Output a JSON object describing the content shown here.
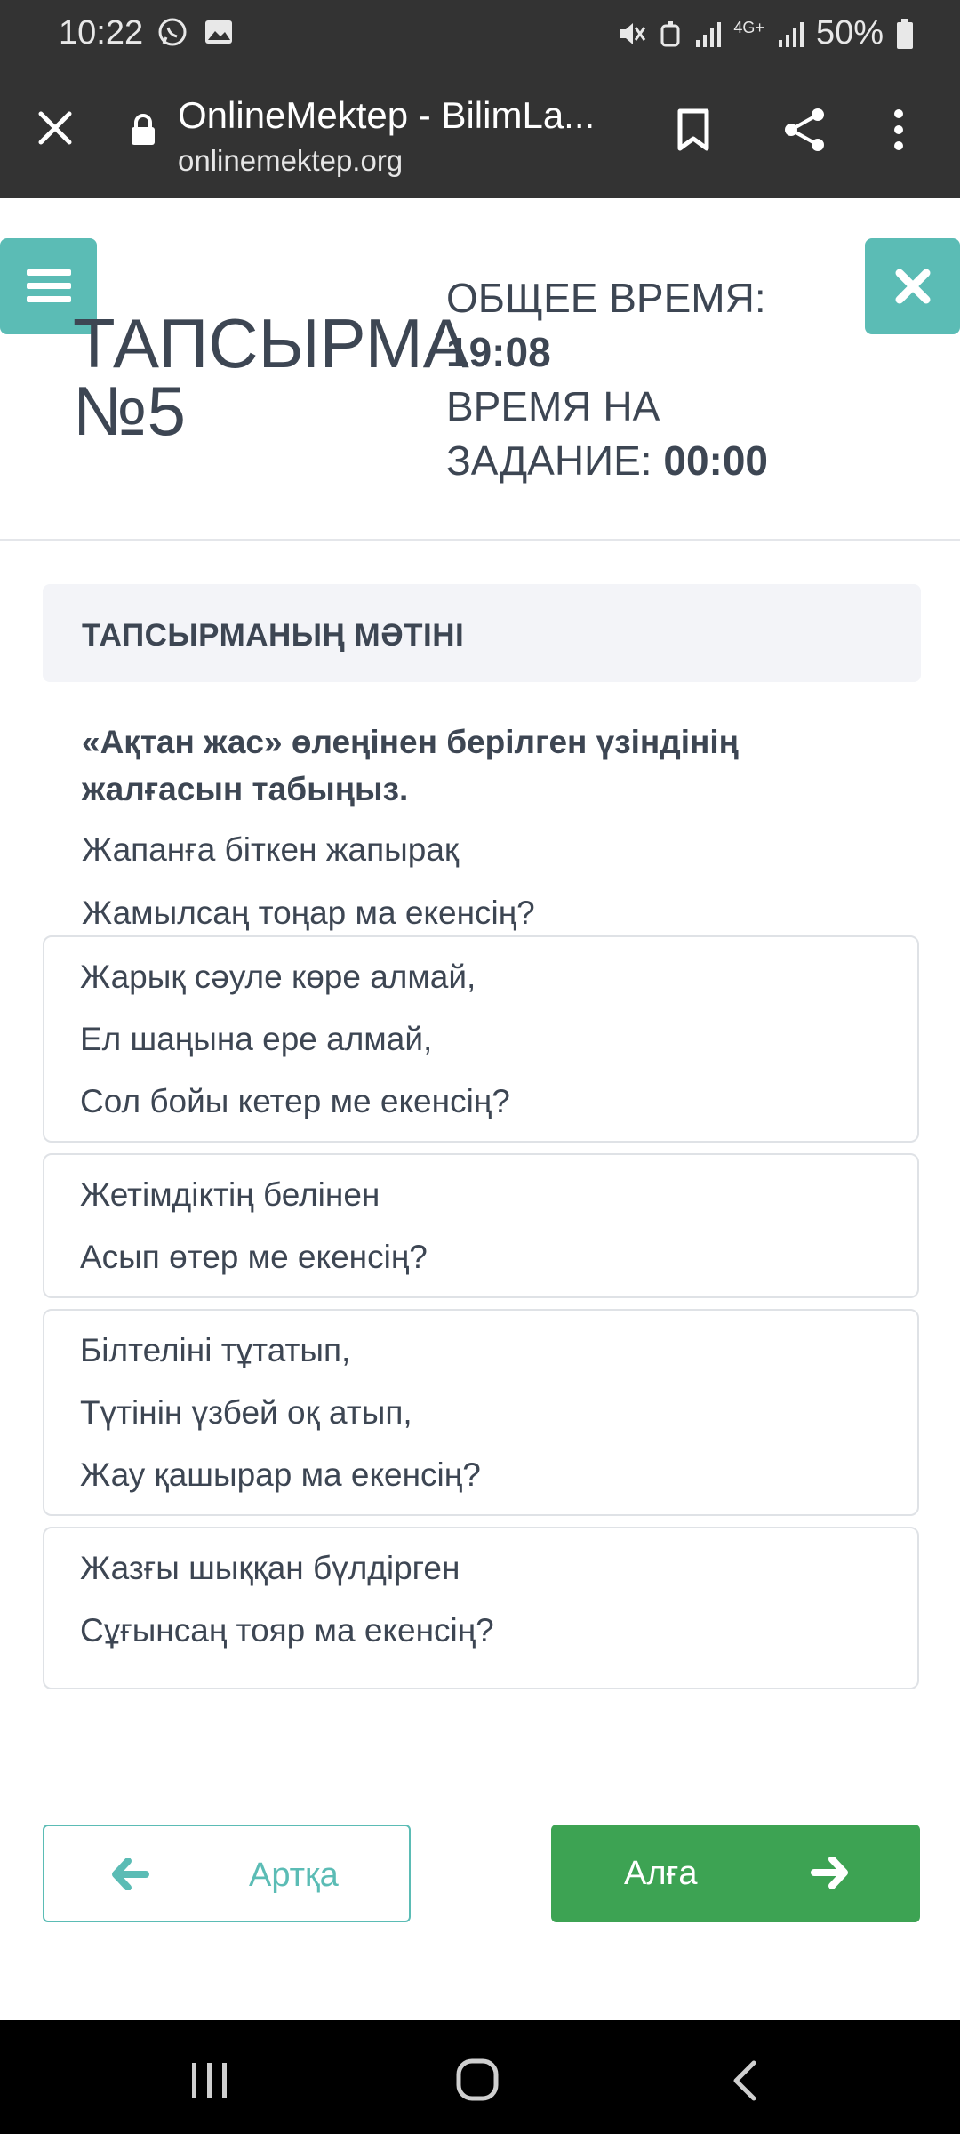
{
  "status_bar": {
    "time": "10:22",
    "battery": "50%",
    "network": "4G+"
  },
  "browser": {
    "title": "OnlineMektep - BilimLa...",
    "url": "onlinemektep.org"
  },
  "task": {
    "title_line1": "ТАПСЫРМА",
    "title_line2": "№5",
    "total_time_label": "ОБЩЕЕ ВРЕМЯ:",
    "total_time_value": "19:08",
    "task_time_label_line1": "ВРЕМЯ НА",
    "task_time_label_line2": "ЗАДАНИЕ:",
    "task_time_value": "00:00"
  },
  "task_text_header": "ТАПСЫРМАНЫҢ МӘТІНІ",
  "question": "«Ақтан жас» өлеңінен берілген үзіндінің жалғасын табыңыз.",
  "given_lines": [
    "Жапанға біткен жапырақ",
    "Жамылсаң тоңар ма екенсің?"
  ],
  "options": [
    {
      "lines": [
        "Жарық сәуле көре алмай,",
        "Ел шаңына ере алмай,",
        "Сол бойы кетер ме екенсің?"
      ]
    },
    {
      "lines": [
        "Жетімдіктің белінен",
        "Асып өтер ме екенсің?"
      ]
    },
    {
      "lines": [
        "Білтеліні тұтатып,",
        "Түтінін үзбей оқ атып,",
        "Жау қашырар ма екенсің?"
      ]
    },
    {
      "lines": [
        "Жазғы шыққан бүлдірген",
        "Сұғынсаң тояр ма екенсің?"
      ]
    }
  ],
  "nav": {
    "prev_label": "Артқа",
    "next_label": "Алға"
  },
  "colors": {
    "teal": "#5bbcb5",
    "green": "#3da353",
    "dark_bar": "#333333",
    "text": "#3d4653"
  }
}
